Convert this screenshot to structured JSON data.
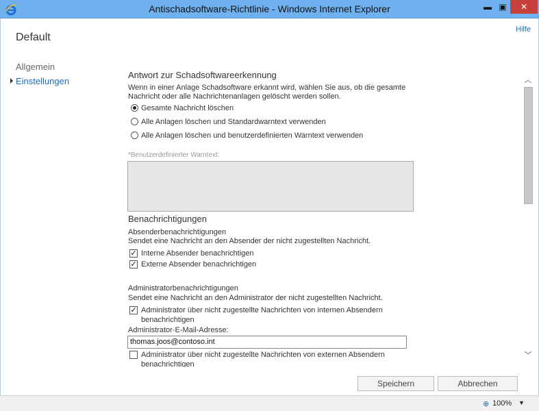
{
  "window": {
    "title": "Antischadsoftware-Richtlinie - Windows Internet Explorer",
    "minimize_glyph": "▬",
    "maximize_glyph": "▣",
    "close_glyph": "✕"
  },
  "header": {
    "help_link": "Hilfe",
    "policy_name": "Default"
  },
  "nav": {
    "items": [
      {
        "label": "Allgemein"
      },
      {
        "label": "Einstellungen"
      }
    ]
  },
  "malware_response": {
    "title": "Antwort zur Schadsoftwareerkennung",
    "description_line1": "Wenn in einer Anlage Schadsoftware erkannt wird, wählen Sie aus, ob die gesamte",
    "description_line2": "Nachricht oder alle Nachrichtenanlagen gelöscht werden sollen.",
    "options": [
      {
        "label": "Gesamte Nachricht löschen",
        "selected": true
      },
      {
        "label": "Alle Anlagen löschen und Standardwarntext verwenden",
        "selected": false
      },
      {
        "label": "Alle Anlagen löschen und benutzerdefinierten Warntext verwenden",
        "selected": false
      }
    ],
    "custom_text_label": "*Benutzerdefinierter Warntext:",
    "custom_text_value": ""
  },
  "notifications": {
    "title": "Benachrichtigungen",
    "sender": {
      "title": "Absenderbenachrichtigungen",
      "description": "Sendet eine Nachricht an den Absender der nicht zugestellten Nachricht.",
      "options": [
        {
          "label": "Interne Absender benachrichtigen",
          "checked": true
        },
        {
          "label": "Externe Absender benachrichtigen",
          "checked": true
        }
      ]
    },
    "admin": {
      "title": "Administratorbenachrichtigungen",
      "description": "Sendet eine Nachricht an den Administrator der nicht zugestellten Nachricht.",
      "internal": {
        "label_line1": "Administrator über nicht zugestellte Nachrichten von internen Absendern",
        "label_line2": "benachrichtigen",
        "checked": true
      },
      "email_label": "Administrator-E-Mail-Adresse:",
      "email_value": "thomas.joos@contoso.int",
      "external": {
        "label_line1": "Administrator über nicht zugestellte Nachrichten von externen Absendern",
        "label_line2": "benachrichtigen",
        "checked": false
      }
    }
  },
  "buttons": {
    "save": "Speichern",
    "cancel": "Abbrechen"
  },
  "statusbar": {
    "zoom": "100%"
  },
  "colors": {
    "titlebar": "#6fb1ef",
    "close": "#c7413a",
    "link": "#1b6ec2"
  }
}
